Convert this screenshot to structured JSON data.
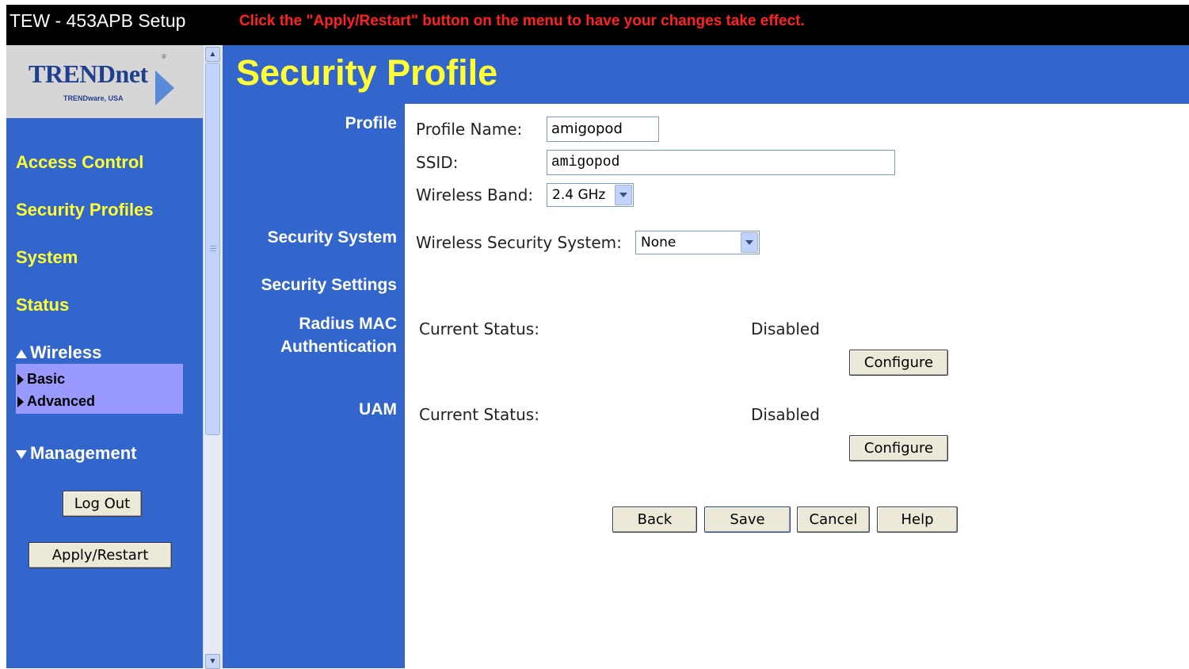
{
  "app": {
    "title": "TEW - 453APB Setup",
    "notice": "Click the \"Apply/Restart\" button on the menu to have your changes take effect."
  },
  "logo": {
    "name": "TRENDnet",
    "tagline": "TRENDware, USA",
    "reg": "®"
  },
  "sidebar": {
    "links": [
      "Access Control",
      "Security Profiles",
      "System",
      "Status"
    ],
    "wireless_label": "Wireless",
    "wireless_items": [
      "Basic",
      "Advanced"
    ],
    "management_label": "Management",
    "logout_label": "Log Out",
    "apply_label": "Apply/Restart"
  },
  "page": {
    "title": "Security Profile"
  },
  "sections": {
    "profile": "Profile",
    "security_system": "Security System",
    "security_settings": "Security Settings",
    "radius_mac_line1": "Radius MAC",
    "radius_mac_line2": "Authentication",
    "uam": "UAM"
  },
  "profile": {
    "name_label": "Profile Name:",
    "name_value": "amigopod",
    "ssid_label": "SSID:",
    "ssid_value": "amigopod",
    "band_label": "Wireless Band:",
    "band_value": "2.4 GHz"
  },
  "security": {
    "system_label": "Wireless Security System:",
    "system_value": "None"
  },
  "radius": {
    "status_label": "Current Status:",
    "status_value": "Disabled",
    "configure_label": "Configure"
  },
  "uam": {
    "status_label": "Current Status:",
    "status_value": "Disabled",
    "configure_label": "Configure"
  },
  "actions": {
    "back": "Back",
    "save": "Save",
    "cancel": "Cancel",
    "help": "Help"
  },
  "colors": {
    "frame_blue": "#3366cc",
    "link_yellow": "#ffff33",
    "notice_red": "#ff2222",
    "submenu_violet": "#9999ff"
  }
}
